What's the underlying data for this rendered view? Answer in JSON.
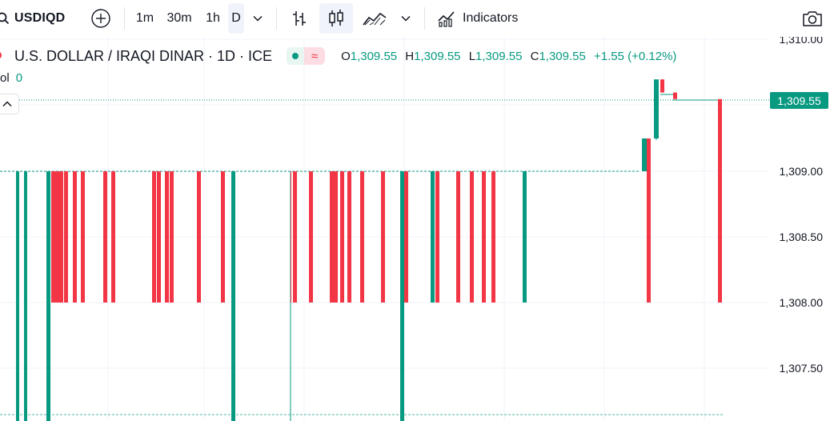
{
  "toolbar": {
    "symbol": "USDIQD",
    "intervals": [
      "1m",
      "30m",
      "1h",
      "D"
    ],
    "active_interval": "D",
    "indicators_label": "Indicators"
  },
  "legend": {
    "title": "U.S. DOLLAR / IRAQI DINAR · 1D · ICE",
    "open_label": "O",
    "open": "1,309.55",
    "high_label": "H",
    "high": "1,309.55",
    "low_label": "L",
    "low": "1,309.55",
    "close_label": "C",
    "close": "1,309.55",
    "change": "+1.55 (+0.12%)",
    "vol_label": "ol",
    "vol_value": "0"
  },
  "price_axis": {
    "labels": [
      "1,310.00",
      "1,309.00",
      "1,308.50",
      "1,308.00",
      "1,307.50"
    ],
    "current_price": "1,309.55"
  },
  "colors": {
    "up": "#089981",
    "down": "#f23645",
    "grid": "#f0f3fa",
    "text": "#131722"
  },
  "chart_data": {
    "type": "candlestick",
    "symbol": "USDIQD",
    "timeframe": "1D",
    "y_ticks": [
      1307.5,
      1308.0,
      1308.5,
      1309.0,
      1310.0
    ],
    "current_price": 1309.55,
    "candles": [
      {
        "open": 1309.0,
        "close": 1307.0,
        "dir": "up"
      },
      {
        "open": 1309.0,
        "close": 1307.0,
        "dir": "up"
      },
      {
        "open": 1309.0,
        "close": 1307.0,
        "dir": "up"
      },
      {
        "open": 1309.0,
        "close": 1308.0,
        "dir": "down"
      },
      {
        "open": 1309.0,
        "close": 1308.0,
        "dir": "down"
      },
      {
        "open": 1309.0,
        "close": 1308.0,
        "dir": "down"
      },
      {
        "open": 1309.0,
        "close": 1308.0,
        "dir": "down"
      },
      {
        "open": 1309.0,
        "close": 1308.0,
        "dir": "down"
      },
      {
        "open": 1309.0,
        "close": 1308.0,
        "dir": "down"
      },
      {
        "open": 1309.0,
        "close": 1308.0,
        "dir": "down"
      },
      {
        "open": 1309.0,
        "close": 1308.0,
        "dir": "down"
      },
      {
        "open": 1309.0,
        "close": 1308.0,
        "dir": "down"
      },
      {
        "open": 1309.0,
        "close": 1308.0,
        "dir": "down"
      },
      {
        "open": 1309.0,
        "close": 1308.0,
        "dir": "down"
      },
      {
        "open": 1309.0,
        "close": 1308.0,
        "dir": "down"
      },
      {
        "open": 1309.0,
        "close": 1308.0,
        "dir": "down"
      },
      {
        "open": 1309.0,
        "close": 1308.0,
        "dir": "down"
      },
      {
        "open": 1309.0,
        "close": 1307.0,
        "dir": "up"
      },
      {
        "open": 1309.0,
        "close": 1308.0,
        "dir": "down"
      },
      {
        "open": 1309.0,
        "close": 1308.0,
        "dir": "down"
      },
      {
        "open": 1309.0,
        "close": 1308.0,
        "dir": "down"
      },
      {
        "open": 1309.0,
        "close": 1308.0,
        "dir": "down"
      },
      {
        "open": 1309.0,
        "close": 1308.0,
        "dir": "down"
      },
      {
        "open": 1309.0,
        "close": 1308.0,
        "dir": "down"
      },
      {
        "open": 1309.0,
        "close": 1308.0,
        "dir": "down"
      },
      {
        "open": 1309.0,
        "close": 1308.0,
        "dir": "down"
      },
      {
        "open": 1309.0,
        "close": 1308.0,
        "dir": "down"
      },
      {
        "open": 1309.0,
        "close": 1307.0,
        "dir": "up"
      },
      {
        "open": 1309.0,
        "close": 1308.0,
        "dir": "down"
      },
      {
        "open": 1309.0,
        "close": 1308.0,
        "dir": "up"
      },
      {
        "open": 1309.0,
        "close": 1308.0,
        "dir": "down"
      },
      {
        "open": 1309.0,
        "close": 1308.0,
        "dir": "down"
      },
      {
        "open": 1309.0,
        "close": 1308.0,
        "dir": "down"
      },
      {
        "open": 1309.0,
        "close": 1308.0,
        "dir": "down"
      },
      {
        "open": 1309.0,
        "close": 1308.0,
        "dir": "down"
      },
      {
        "open": 1309.0,
        "close": 1308.0,
        "dir": "up"
      },
      {
        "open": 1309.0,
        "close": 1309.25,
        "dir": "up"
      },
      {
        "open": 1309.25,
        "close": 1308.0,
        "dir": "down"
      },
      {
        "open": 1309.25,
        "close": 1309.7,
        "dir": "up"
      },
      {
        "open": 1309.7,
        "close": 1309.6,
        "dir": "down"
      },
      {
        "open": 1309.6,
        "close": 1309.55,
        "dir": "down"
      },
      {
        "open": 1309.55,
        "close": 1308.0,
        "dir": "down"
      }
    ]
  }
}
